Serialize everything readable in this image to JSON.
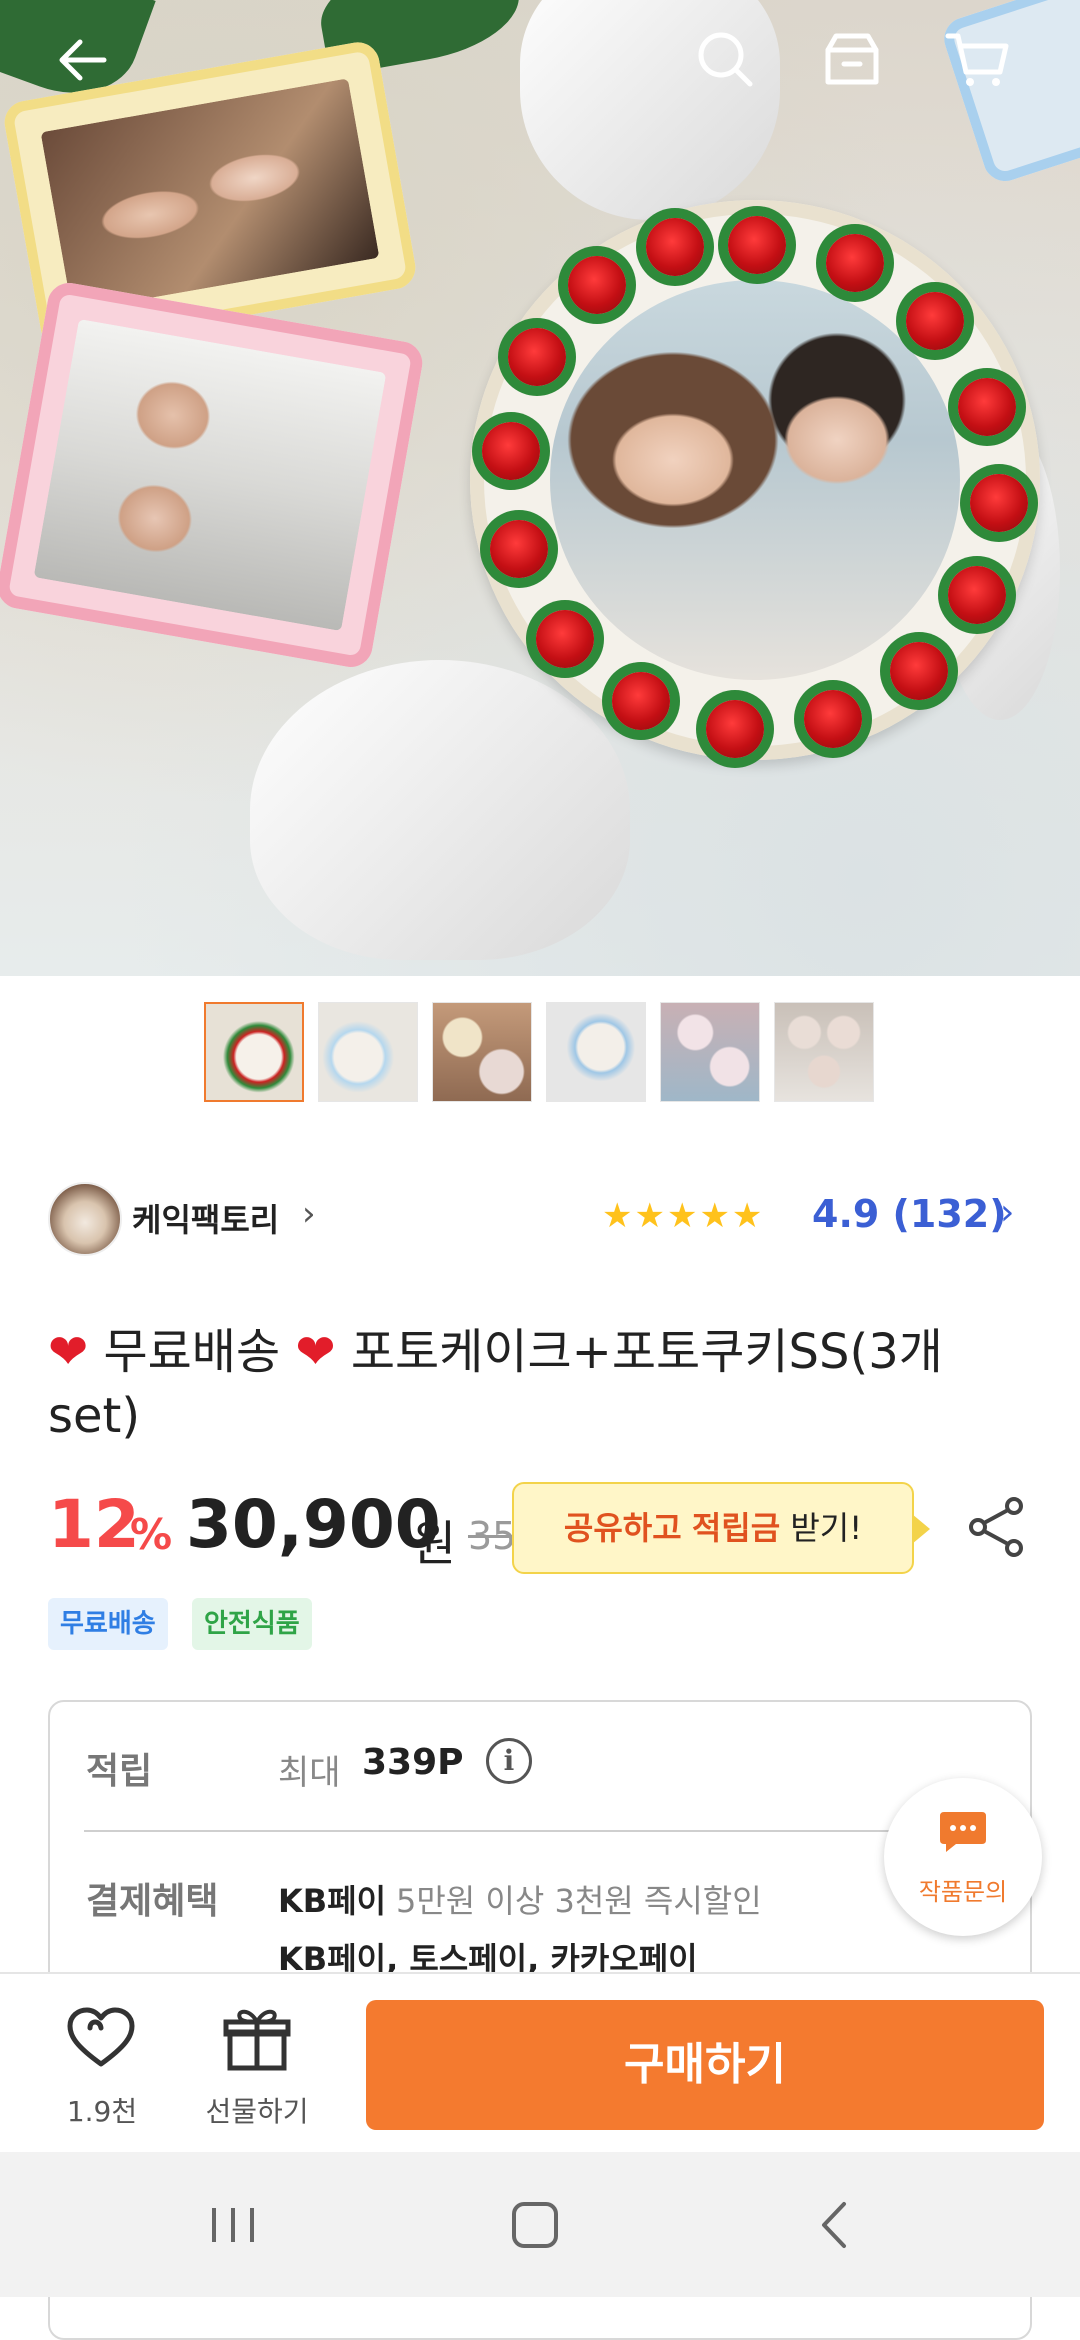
{
  "hero": {
    "back_icon": "arrow-left-icon",
    "search_icon": "search-icon",
    "store_icon": "store-icon",
    "cart_icon": "cart-icon"
  },
  "thumbnails": [
    "thumb-1",
    "thumb-2",
    "thumb-3",
    "thumb-4",
    "thumb-5",
    "thumb-6"
  ],
  "seller": {
    "name": "케익팩토리",
    "chevron": "›",
    "stars": "★★★★★",
    "rating": "4.9 (132)",
    "rating_chevron": "›"
  },
  "product": {
    "title_part1": "무료배송",
    "title_part2": "포토케이크+포토쿠키SS(3개 set)",
    "heart": "❤"
  },
  "price": {
    "discount": "12",
    "discount_sign": "%",
    "current": "30,900",
    "unit": "원",
    "original": "35"
  },
  "share_tip": {
    "highlight1": "공유하고",
    "highlight2": "적립금",
    "rest": "받기!"
  },
  "badges": {
    "free_shipping": "무료배송",
    "safe_food": "안전식품"
  },
  "benefits": {
    "points_label": "적립",
    "points_prefix": "최대",
    "points_value": "339P",
    "info_glyph": "i",
    "payment_label": "결제혜택",
    "payment_method": "KB페이",
    "payment_desc": "5만원 이상 3천원 즉시할인",
    "payment_line2": "KB페이, 토스페이, 카카오페이"
  },
  "inquiry": {
    "label": "작품문의"
  },
  "action_bar": {
    "like_count": "1.9천",
    "gift_label": "선물하기",
    "buy_label": "구매하기"
  },
  "colors": {
    "accent": "#f47a2f",
    "discount": "#f54a4a",
    "rating": "#3b5fd4",
    "star": "#ffc21c"
  }
}
